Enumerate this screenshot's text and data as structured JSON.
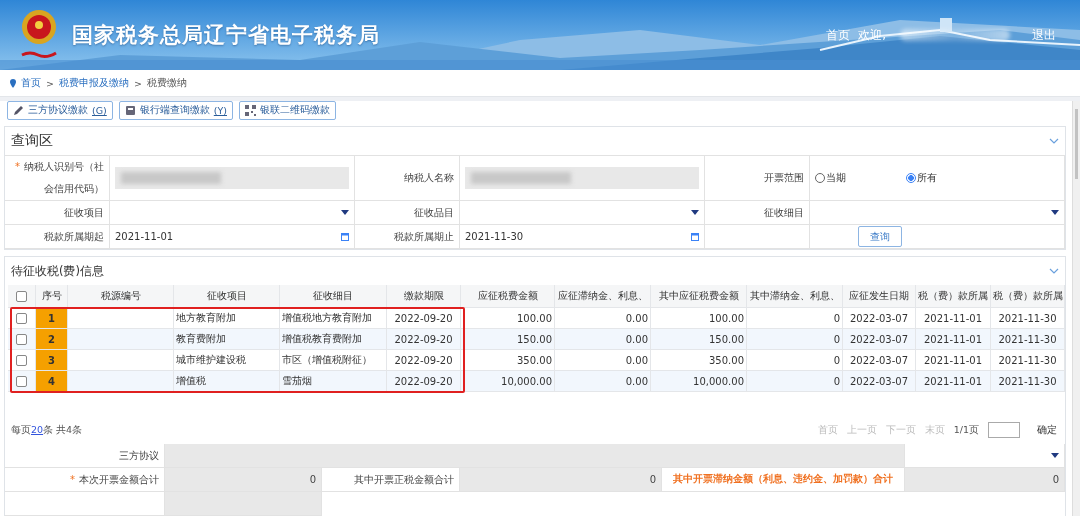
{
  "header": {
    "title": "国家税务总局辽宁省电子税务局",
    "nav": [
      {
        "label": "首页"
      },
      {
        "label": "欢迎,"
      }
    ],
    "logout": "退出"
  },
  "breadcrumb": [
    "首页",
    "税费申报及缴纳",
    "税费缴纳"
  ],
  "breadcrumb_separator": ">",
  "required_mark": "*",
  "toolbar": [
    {
      "label": "三方协议缴款",
      "shortcut": "(G)",
      "kind": "pencil"
    },
    {
      "label": "银行端查询缴款",
      "shortcut": "(Y)",
      "kind": "terminal"
    },
    {
      "label": "银联二维码缴款",
      "kind": "qr"
    }
  ],
  "query": {
    "title": "查询区",
    "taxpayer_id": {
      "label": "纳税人识别号（社会信用代码）",
      "required": true
    },
    "taxpayer_name": {
      "label": "纳税人名称"
    },
    "invoice_range": {
      "label": "开票范围",
      "options": [
        {
          "label": "当期",
          "selected": false
        },
        {
          "label": "所有",
          "selected": true
        }
      ]
    },
    "levy_item": {
      "label": "征收项目"
    },
    "levy_category": {
      "label": "征收品目"
    },
    "levy_detail": {
      "label": "征收细目"
    },
    "period_start": {
      "label": "税款所属期起",
      "value": "2021-11-01"
    },
    "period_end": {
      "label": "税款所属期止",
      "value": "2021-11-30"
    },
    "search_button": "查询"
  },
  "table": {
    "title": "待征收税(费)信息",
    "all_checked": false,
    "columns": [
      "序号",
      "税源编号",
      "征收项目",
      "征收细目",
      "缴款期限",
      "应征税费金额",
      "应征滞纳金、利息、",
      "其中应征税费金额",
      "其中滞纳金、利息、",
      "应征发生日期",
      "税（费）款所属",
      "税（费）款所属"
    ],
    "rows": [
      {
        "checked": false,
        "highlighted": true,
        "cells": [
          "1",
          "",
          "地方教育附加",
          "增值税地方教育附加",
          "2022-09-20",
          "100.00",
          "0.00",
          "100.00",
          "0",
          "2022-03-07",
          "2021-11-01",
          "2021-11-30"
        ]
      },
      {
        "checked": false,
        "highlighted": true,
        "cells": [
          "2",
          "",
          "教育费附加",
          "增值税教育费附加",
          "2022-09-20",
          "150.00",
          "0.00",
          "150.00",
          "0",
          "2022-03-07",
          "2021-11-01",
          "2021-11-30"
        ]
      },
      {
        "checked": false,
        "highlighted": true,
        "cells": [
          "3",
          "",
          "城市维护建设税",
          "市区（增值税附征）",
          "2022-09-20",
          "350.00",
          "0.00",
          "350.00",
          "0",
          "2022-03-07",
          "2021-11-01",
          "2021-11-30"
        ]
      },
      {
        "checked": false,
        "highlighted": true,
        "cells": [
          "4",
          "",
          "增值税",
          "雪茄烟",
          "2022-09-20",
          "10,000.00",
          "0.00",
          "10,000.00",
          "0",
          "2022-03-07",
          "2021-11-01",
          "2021-11-30"
        ]
      }
    ],
    "page_size_prefix": "每页",
    "page_size": "20",
    "page_size_suffix": "条 共4条",
    "pager": [
      {
        "label": "首页",
        "disabled": true
      },
      {
        "label": "上一页",
        "disabled": true
      },
      {
        "label": "下一页",
        "disabled": true
      },
      {
        "label": "末页",
        "disabled": true
      }
    ],
    "page_info": "1/1页",
    "confirm": "确定"
  },
  "summary": {
    "agreement_label": "三方协议",
    "fields": [
      {
        "label": "本次开票金额合计",
        "required": true,
        "value": "0",
        "kind": "normal"
      },
      {
        "label": "其中开票正税金额合计",
        "required": false,
        "value": "0",
        "kind": "normal"
      },
      {
        "label": "其中开票滞纳金额（利息、违约金、加罚款）合计",
        "required": false,
        "value": "0",
        "kind": "warning"
      }
    ]
  }
}
